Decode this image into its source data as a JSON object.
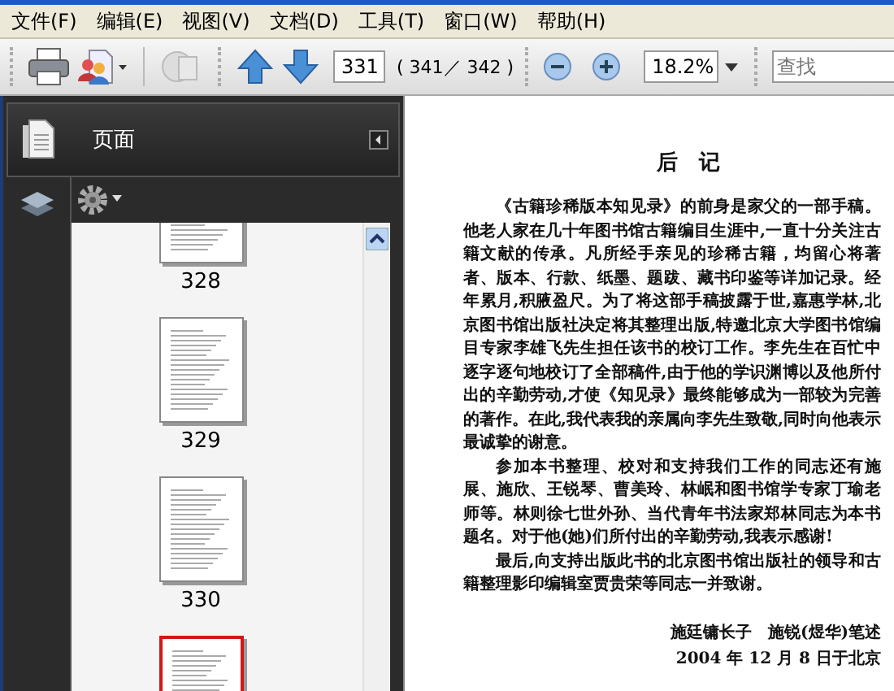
{
  "menu": [
    {
      "label": "文件(F)"
    },
    {
      "label": "编辑(E)"
    },
    {
      "label": "视图(V)"
    },
    {
      "label": "文档(D)"
    },
    {
      "label": "工具(T)"
    },
    {
      "label": "窗口(W)"
    },
    {
      "label": "帮助(H)"
    }
  ],
  "toolbar": {
    "page_field": "331",
    "page_count": "( 341／ 342 )",
    "zoom": "18.2%",
    "search": {
      "placeholder": "查找"
    }
  },
  "sidebar": {
    "title": "页面",
    "thumbnails": [
      {
        "label": "328",
        "selected": false
      },
      {
        "label": "329",
        "selected": false
      },
      {
        "label": "330",
        "selected": false
      },
      {
        "selected": true
      }
    ]
  },
  "document": {
    "title": "后　记",
    "paragraphs": [
      "《古籍珍稀版本知见录》的前身是家父的一部手稿。他老人家在几十年图书馆古籍编目生涯中,一直十分关注古籍文献的传承。凡所经手亲见的珍稀古籍，均留心将著者、版本、行款、纸墨、题跋、藏书印鉴等详加记录。经年累月,积腋盈尺。为了将这部手稿披露于世,嘉惠学林,北京图书馆出版社决定将其整理出版,特邀北京大学图书馆编目专家李雄飞先生担任该书的校订工作。李先生在百忙中逐字逐句地校订了全部稿件,由于他的学识渊博以及他所付出的辛勤劳动,才使《知见录》最终能够成为一部较为完善的著作。在此,我代表我的亲属向李先生致敬,同时向他表示最诚挚的谢意。",
      "参加本书整理、校对和支持我们工作的同志还有施展、施欣、王锐琴、曹美玲、林岷和图书馆学专家丁瑜老师等。林则徐七世外孙、当代青年书法家郑林同志为本书题名。对于他(她)们所付出的辛勤劳动,我表示感谢!",
      "最后,向支持出版此书的北京图书馆出版社的领导和古籍整理影印编辑室贾贵荣等同志一并致谢。"
    ],
    "signature": [
      "施廷镛长子　施锐(煜华)笔述",
      "2004 年 12 月 8 日于北京"
    ]
  }
}
